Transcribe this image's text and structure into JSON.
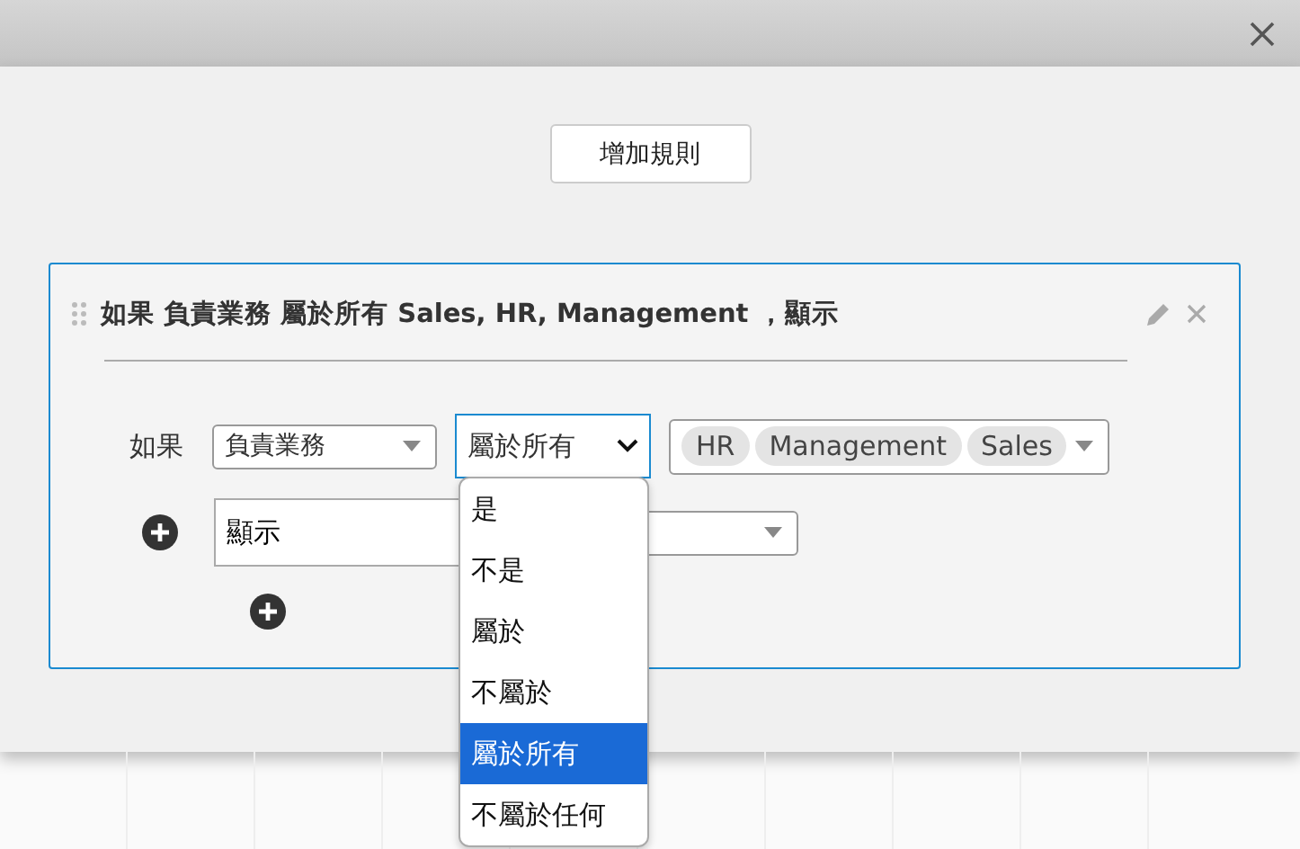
{
  "add_rule_button": "增加規則",
  "rule": {
    "summary": "如果 負責業務 屬於所有 Sales, HR, Management ，顯示",
    "condition": {
      "label": "如果",
      "field": "負責業務",
      "operator": "屬於所有",
      "values": [
        "HR",
        "Management",
        "Sales"
      ]
    },
    "action": {
      "value": "顯示"
    }
  },
  "operator_menu": {
    "options": [
      {
        "label": "是",
        "selected": false
      },
      {
        "label": "不是",
        "selected": false
      },
      {
        "label": "屬於",
        "selected": false
      },
      {
        "label": "不屬於",
        "selected": false
      },
      {
        "label": "屬於所有",
        "selected": true
      },
      {
        "label": "不屬於任何",
        "selected": false
      }
    ]
  }
}
